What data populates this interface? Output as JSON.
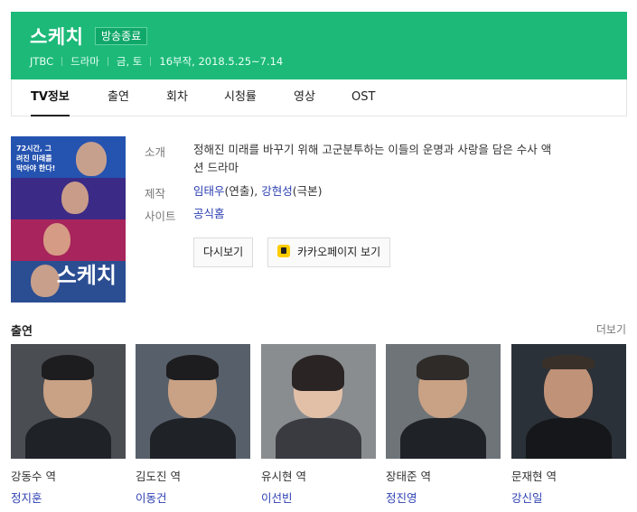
{
  "header": {
    "title": "스케치",
    "status_badge": "방송종료",
    "meta": [
      "JTBC",
      "드라마",
      "금, 토",
      "16부작, 2018.5.25~7.14"
    ],
    "bg_color": "#1db979"
  },
  "tabs": [
    {
      "label": "TV정보",
      "active": true
    },
    {
      "label": "출연",
      "active": false
    },
    {
      "label": "회차",
      "active": false
    },
    {
      "label": "시청률",
      "active": false
    },
    {
      "label": "영상",
      "active": false
    },
    {
      "label": "OST",
      "active": false
    }
  ],
  "poster": {
    "tagline": "72시간, 그려진 미래를 막아야 한다!",
    "title": "스케치"
  },
  "info": {
    "intro_label": "소개",
    "intro_text_1": "정해진 미래를 바꾸기 위해 고군분투하는 이들의 운명과 사랑을 담은 수사 액",
    "intro_text_2": "션 드라마",
    "production_label": "제작",
    "director": "임태우",
    "director_role": "(연출), ",
    "writer": "강현성",
    "writer_role": "(극본)",
    "site_label": "사이트",
    "site_link": "공식홈",
    "rewatch_button": "다시보기",
    "kakao_button": "카카오페이지 보기"
  },
  "cast_section": {
    "title": "출연",
    "more": "더보기",
    "members": [
      {
        "role": "강동수 역",
        "actor": "정지훈"
      },
      {
        "role": "김도진 역",
        "actor": "이동건"
      },
      {
        "role": "유시현 역",
        "actor": "이선빈"
      },
      {
        "role": "장태준 역",
        "actor": "정진영"
      },
      {
        "role": "문재현 역",
        "actor": "강신일"
      }
    ]
  }
}
